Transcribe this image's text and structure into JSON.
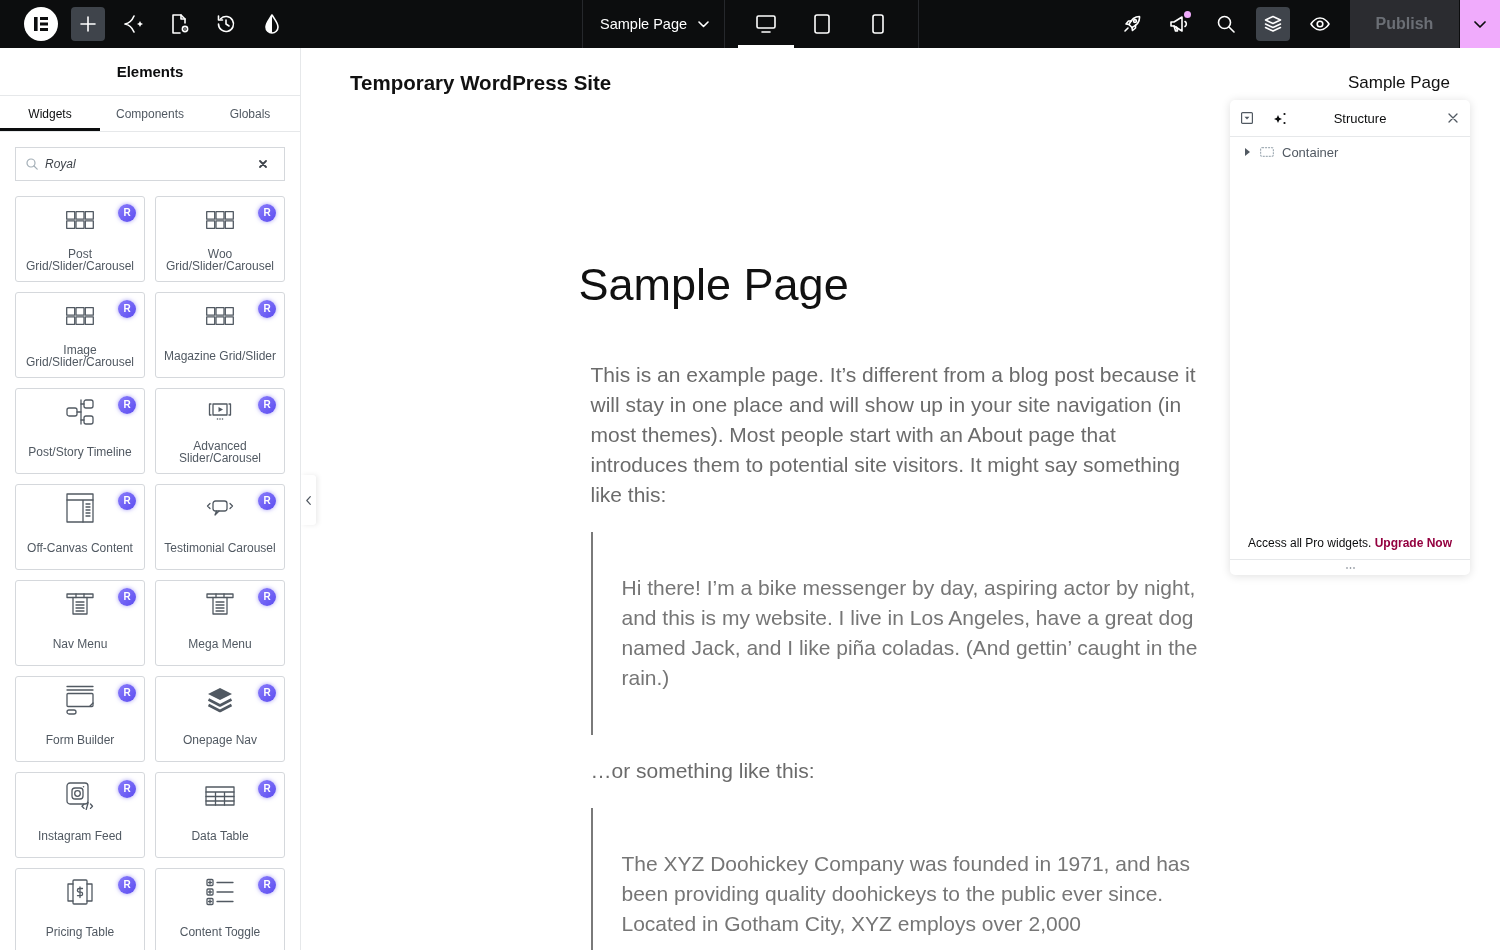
{
  "top_bar": {
    "tools": [
      {
        "selected": true
      },
      {
        "selected": false
      },
      {
        "selected": false
      },
      {
        "selected": false
      },
      {
        "selected": false
      }
    ],
    "page_selector": {
      "label": "Sample Page"
    },
    "devices": [
      {
        "selected": true
      },
      {
        "selected": false
      },
      {
        "selected": false
      }
    ],
    "actions": [
      {
        "selected": false,
        "notification": false
      },
      {
        "selected": false,
        "notification": true
      },
      {
        "selected": false,
        "notification": false
      },
      {
        "selected": true,
        "notification": false
      },
      {
        "selected": false,
        "notification": false
      }
    ],
    "publish": {
      "label": "Publish",
      "disabled": true
    }
  },
  "elements_panel": {
    "title": "Elements",
    "tabs": [
      {
        "label": "Widgets",
        "selected": true
      },
      {
        "label": "Components",
        "selected": false
      },
      {
        "label": "Globals",
        "selected": false
      }
    ],
    "search": {
      "value": "Royal"
    },
    "widgets": [
      {
        "label": "Post Grid/Slider/Carousel",
        "badge": "R"
      },
      {
        "label": "Woo Grid/Slider/Carousel",
        "badge": "R"
      },
      {
        "label": "Image Grid/Slider/Carousel",
        "badge": "R"
      },
      {
        "label": "Magazine Grid/Slider",
        "badge": "R"
      },
      {
        "label": "Post/Story Timeline",
        "badge": "R"
      },
      {
        "label": "Advanced Slider/Carousel",
        "badge": "R"
      },
      {
        "label": "Off-Canvas Content",
        "badge": "R"
      },
      {
        "label": "Testimonial Carousel",
        "badge": "R"
      },
      {
        "label": "Nav Menu",
        "badge": "R"
      },
      {
        "label": "Mega Menu",
        "badge": "R"
      },
      {
        "label": "Form Builder",
        "badge": "R"
      },
      {
        "label": "Onepage Nav",
        "badge": "R"
      },
      {
        "label": "Instagram Feed",
        "badge": "R"
      },
      {
        "label": "Data Table",
        "badge": "R"
      },
      {
        "label": "Pricing Table",
        "badge": "R"
      },
      {
        "label": "Content Toggle",
        "badge": "R"
      }
    ]
  },
  "canvas": {
    "site_title": "Temporary WordPress Site",
    "nav_link": "Sample Page",
    "heading": "Sample Page",
    "blocks": [
      {
        "kind": "paragraph",
        "text": "This is an example page. It’s different from a blog post because it will stay in one place and will show up in your site navigation (in most themes). Most people start with an About page that introduces them to potential site visitors. It might say something like this:"
      },
      {
        "kind": "quote",
        "text": "Hi there! I’m a bike messenger by day, aspiring actor by night, and this is my website. I live in Los Angeles, have a great dog named Jack, and I like piña coladas. (And gettin’ caught in the rain.)"
      },
      {
        "kind": "paragraph",
        "text": "…or something like this:"
      },
      {
        "kind": "quote",
        "text": "The XYZ Doohickey Company was founded in 1971, and has been providing quality doohickeys to the public ever since. Located in Gotham City, XYZ employs over 2,000"
      }
    ]
  },
  "structure_panel": {
    "title": "Structure",
    "tree": [
      {
        "label": "Container",
        "expanded": false
      }
    ],
    "promo": {
      "text": "Access all Pro widgets.",
      "link": "Upgrade Now"
    }
  }
}
